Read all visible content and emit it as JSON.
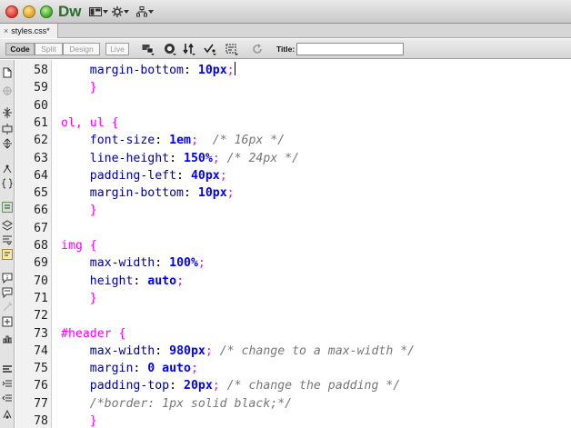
{
  "window": {
    "app_logo": "Dw"
  },
  "tab": {
    "close_glyph": "×",
    "filename": "styles.css*"
  },
  "doc_toolbar": {
    "views": [
      {
        "label": "Code",
        "active": true
      },
      {
        "label": "Split",
        "active": false
      },
      {
        "label": "Design",
        "active": false
      },
      {
        "label": "Live",
        "active": false
      }
    ],
    "title_label": "Title:",
    "title_value": ""
  },
  "editor": {
    "lines": [
      {
        "n": "58",
        "segs": [
          {
            "t": "    ",
            "c": ""
          },
          {
            "t": "margin-bottom",
            "c": "prop"
          },
          {
            "t": ": ",
            "c": ""
          },
          {
            "t": "10px",
            "c": "val"
          },
          {
            "t": ";",
            "c": "sel"
          }
        ],
        "caret": true
      },
      {
        "n": "59",
        "segs": [
          {
            "t": "    }",
            "c": "sel"
          }
        ]
      },
      {
        "n": "60",
        "segs": []
      },
      {
        "n": "61",
        "segs": [
          {
            "t": "ol, ul {",
            "c": "sel"
          }
        ]
      },
      {
        "n": "62",
        "segs": [
          {
            "t": "    ",
            "c": ""
          },
          {
            "t": "font-size",
            "c": "prop"
          },
          {
            "t": ": ",
            "c": ""
          },
          {
            "t": "1em",
            "c": "val"
          },
          {
            "t": ";  ",
            "c": "sel"
          },
          {
            "t": "/* 16px */",
            "c": "cmt"
          }
        ]
      },
      {
        "n": "63",
        "segs": [
          {
            "t": "    ",
            "c": ""
          },
          {
            "t": "line-height",
            "c": "prop"
          },
          {
            "t": ": ",
            "c": ""
          },
          {
            "t": "150%",
            "c": "val"
          },
          {
            "t": "; ",
            "c": "sel"
          },
          {
            "t": "/* 24px */",
            "c": "cmt"
          }
        ]
      },
      {
        "n": "64",
        "segs": [
          {
            "t": "    ",
            "c": ""
          },
          {
            "t": "padding-left",
            "c": "prop"
          },
          {
            "t": ": ",
            "c": ""
          },
          {
            "t": "40px",
            "c": "val"
          },
          {
            "t": ";",
            "c": "sel"
          }
        ]
      },
      {
        "n": "65",
        "segs": [
          {
            "t": "    ",
            "c": ""
          },
          {
            "t": "margin-bottom",
            "c": "prop"
          },
          {
            "t": ": ",
            "c": ""
          },
          {
            "t": "10px",
            "c": "val"
          },
          {
            "t": ";",
            "c": "sel"
          }
        ]
      },
      {
        "n": "66",
        "segs": [
          {
            "t": "    }",
            "c": "sel"
          }
        ]
      },
      {
        "n": "67",
        "segs": []
      },
      {
        "n": "68",
        "segs": [
          {
            "t": "img {",
            "c": "sel"
          }
        ]
      },
      {
        "n": "69",
        "segs": [
          {
            "t": "    ",
            "c": ""
          },
          {
            "t": "max-width",
            "c": "prop"
          },
          {
            "t": ": ",
            "c": ""
          },
          {
            "t": "100%",
            "c": "val"
          },
          {
            "t": ";",
            "c": "sel"
          }
        ]
      },
      {
        "n": "70",
        "segs": [
          {
            "t": "    ",
            "c": ""
          },
          {
            "t": "height",
            "c": "prop"
          },
          {
            "t": ": ",
            "c": ""
          },
          {
            "t": "auto",
            "c": "val"
          },
          {
            "t": ";",
            "c": "sel"
          }
        ]
      },
      {
        "n": "71",
        "segs": [
          {
            "t": "    }",
            "c": "sel"
          }
        ]
      },
      {
        "n": "72",
        "segs": []
      },
      {
        "n": "73",
        "segs": [
          {
            "t": "#header {",
            "c": "sel"
          }
        ]
      },
      {
        "n": "74",
        "segs": [
          {
            "t": "    ",
            "c": ""
          },
          {
            "t": "max-width",
            "c": "prop"
          },
          {
            "t": ": ",
            "c": ""
          },
          {
            "t": "980px",
            "c": "val"
          },
          {
            "t": "; ",
            "c": "sel"
          },
          {
            "t": "/* change to a max-width */",
            "c": "cmt"
          }
        ]
      },
      {
        "n": "75",
        "segs": [
          {
            "t": "    ",
            "c": ""
          },
          {
            "t": "margin",
            "c": "prop"
          },
          {
            "t": ": ",
            "c": ""
          },
          {
            "t": "0 auto",
            "c": "val"
          },
          {
            "t": ";",
            "c": "sel"
          }
        ]
      },
      {
        "n": "76",
        "segs": [
          {
            "t": "    ",
            "c": ""
          },
          {
            "t": "padding-top",
            "c": "prop"
          },
          {
            "t": ": ",
            "c": ""
          },
          {
            "t": "20px",
            "c": "val"
          },
          {
            "t": "; ",
            "c": "sel"
          },
          {
            "t": "/* change the padding */",
            "c": "cmt"
          }
        ]
      },
      {
        "n": "77",
        "segs": [
          {
            "t": "    ",
            "c": ""
          },
          {
            "t": "/*border: 1px solid black;*/",
            "c": "cmt"
          }
        ]
      },
      {
        "n": "78",
        "segs": [
          {
            "t": "    }",
            "c": "sel"
          }
        ]
      }
    ]
  },
  "colors": {
    "selector": "#ff00ff",
    "property": "#000099",
    "value": "#0000ff",
    "comment": "#777777",
    "gutter_bg": "#f2f2f2"
  },
  "icons": {
    "title_bar": [
      "close-window-icon",
      "minimize-window-icon",
      "zoom-window-icon",
      "layout-icon",
      "extensions-icon",
      "site-icon"
    ],
    "doc_toolbar": [
      "multiscreen-icon",
      "preview-in-browser-icon",
      "file-management-icon",
      "w3c-validation-icon",
      "visual-aids-icon",
      "refresh-icon"
    ],
    "coding_toolbar": [
      "open-documents-icon",
      "show-code-navigator-icon",
      "collapse-full-tag-icon",
      "collapse-selection-icon",
      "expand-all-icon",
      "select-parent-tag-icon",
      "balance-braces-icon",
      "line-numbers-icon",
      "highlight-invalid-code-icon",
      "syntax-coloring-icon",
      "word-wrap-icon",
      "info-icon",
      "apply-comment-icon",
      "remove-comment-icon",
      "wrap-tag-icon",
      "recent-snippets-icon",
      "move-css-icon",
      "indent-code-icon",
      "outdent-code-icon",
      "format-source-code-icon"
    ]
  }
}
